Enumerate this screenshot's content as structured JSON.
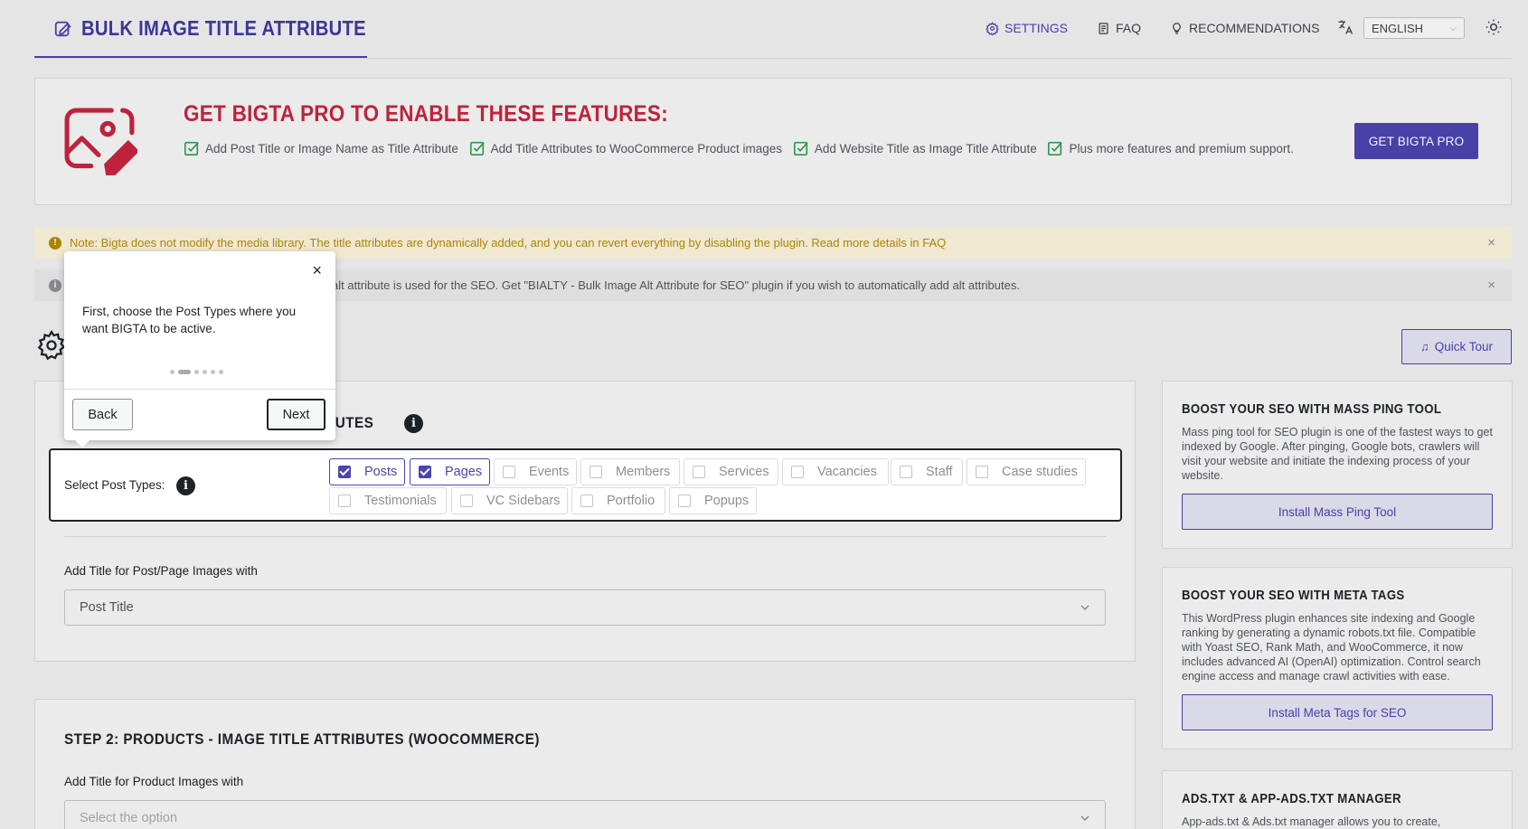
{
  "header": {
    "title": "BULK IMAGE TITLE ATTRIBUTE",
    "nav": [
      {
        "label": "SETTINGS",
        "icon": "gear-icon",
        "active": true
      },
      {
        "label": "FAQ",
        "icon": "document-icon",
        "active": false
      },
      {
        "label": "RECOMMENDATIONS",
        "icon": "lightbulb-icon",
        "active": false
      }
    ],
    "language": "ENGLISH"
  },
  "promo": {
    "title": "GET BIGTA PRO TO ENABLE THESE FEATURES:",
    "features": [
      "Add Post Title or Image Name as Title Attribute",
      "Add Title Attributes to WooCommerce Product images",
      "Add Website Title as Image Title Attribute",
      "Plus more features and premium support."
    ],
    "button": "GET BIGTA PRO"
  },
  "notices": [
    {
      "text": "Note: Bigta does not modify the media library. The title attributes are dynamically added, and you can revert everything by disabling the plugin. Read more details in FAQ",
      "close": "×"
    },
    {
      "text": "alt attribute is used for the SEO. Get \"BIALTY - Bulk Image Alt Attribute for SEO\" plugin if you wish to automatically add alt attributes.",
      "close": "×"
    }
  ],
  "quick_tour": "Quick Tour",
  "step1": {
    "title_visible": "RIBUTES",
    "select_post_types_label": "Select Post Types:",
    "post_types": [
      {
        "label": "Posts",
        "checked": true
      },
      {
        "label": "Pages",
        "checked": true
      },
      {
        "label": "Events",
        "checked": false
      },
      {
        "label": "Members",
        "checked": false
      },
      {
        "label": "Services",
        "checked": false
      },
      {
        "label": "Vacancies",
        "checked": false
      },
      {
        "label": "Staff",
        "checked": false
      },
      {
        "label": "Case studies",
        "checked": false
      },
      {
        "label": "Testimonials",
        "checked": false
      },
      {
        "label": "VC Sidebars",
        "checked": false
      },
      {
        "label": "Portfolio",
        "checked": false
      },
      {
        "label": "Popups",
        "checked": false
      }
    ],
    "add_title_label": "Add Title for Post/Page Images with",
    "add_title_value": "Post Title"
  },
  "step2": {
    "title": "STEP 2: PRODUCTS - IMAGE TITLE ATTRIBUTES (WOOCOMMERCE)",
    "add_title_label": "Add Title for Product Images with",
    "placeholder": "Select the option"
  },
  "sidebar": [
    {
      "title": "BOOST YOUR SEO WITH MASS PING TOOL",
      "text": "Mass ping tool for SEO plugin is one of the fastest ways to get indexed by Google. After pinging, Google bots, crawlers will visit your website and initiate the indexing process of your website.",
      "button": "Install Mass Ping Tool"
    },
    {
      "title": "BOOST YOUR SEO WITH META TAGS",
      "text": "This WordPress plugin enhances site indexing and Google ranking by generating a dynamic robots.txt file. Compatible with Yoast SEO, Rank Math, and WooCommerce, it now includes advanced AI (OpenAI) optimization. Control search engine access and manage crawl activities with ease.",
      "button": "Install Meta Tags for SEO"
    },
    {
      "title": "ADS.TXT & APP-ADS.TXT MANAGER",
      "text": "App-ads.txt & Ads.txt manager allows you to create,"
    }
  ],
  "tour": {
    "text": "First, choose the Post Types where you want BIGTA to be active.",
    "close": "×",
    "back": "Back",
    "next": "Next",
    "step": 2,
    "total_steps": 6
  },
  "colors": {
    "accent": "#4b44b0",
    "promo_title": "#c7253e",
    "check": "#2e9e4f",
    "warning": "#b58a00"
  }
}
